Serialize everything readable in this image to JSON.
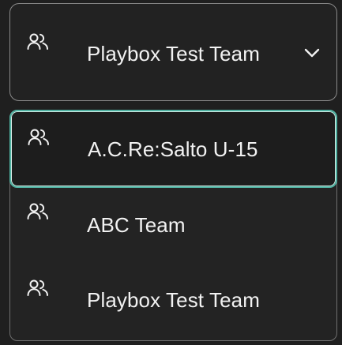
{
  "select": {
    "value": "Playbox Test Team",
    "icon": "team-icon",
    "chevron_icon": "chevron-down-icon"
  },
  "menu": {
    "options": [
      {
        "label": "A.C.Re:Salto U-15",
        "icon": "team-icon",
        "selected": true
      },
      {
        "label": "ABC Team",
        "icon": "team-icon",
        "selected": false
      },
      {
        "label": "Playbox Test Team",
        "icon": "team-icon",
        "selected": false
      }
    ]
  },
  "colors": {
    "background": "#1f1f1f",
    "text": "#f2f2f2",
    "border": "#8a8a8a",
    "selected_border": "#4fb2a2"
  }
}
